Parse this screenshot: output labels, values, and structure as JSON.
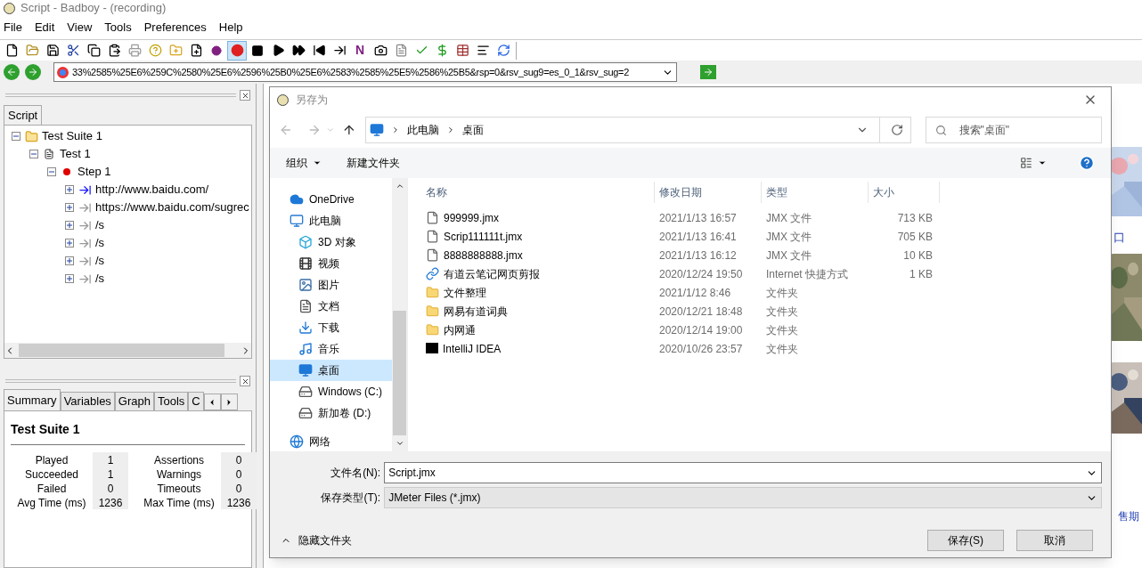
{
  "window": {
    "title": "Script - Badboy - (recording)"
  },
  "menu": [
    "File",
    "Edit",
    "View",
    "Tools",
    "Preferences",
    "Help"
  ],
  "toolbar": {
    "recording": true,
    "n_glyph": "N"
  },
  "address_bar": {
    "value": "33%2585%25E6%259C%2580%25E6%2596%25B0%25E6%2583%2585%25E5%2586%25B5&rsp=0&rsv_sug9=es_0_1&rsv_sug=2"
  },
  "script_panel": {
    "tabs": [
      {
        "label": "Script",
        "selected": true
      }
    ],
    "tree": [
      {
        "label": "Test Suite 1",
        "kind": "suite",
        "expanded": true,
        "children": [
          {
            "label": "Test 1",
            "kind": "test",
            "expanded": true,
            "children": [
              {
                "label": "Step 1",
                "kind": "step",
                "expanded": true,
                "children": [
                  {
                    "label": "http://www.baidu.com/",
                    "kind": "request-active",
                    "expanded": false
                  },
                  {
                    "label": "https://www.baidu.com/sugrec",
                    "kind": "request",
                    "expanded": false
                  },
                  {
                    "label": "/s",
                    "kind": "request",
                    "expanded": false
                  },
                  {
                    "label": "/s",
                    "kind": "request",
                    "expanded": false
                  },
                  {
                    "label": "/s",
                    "kind": "request",
                    "expanded": false
                  },
                  {
                    "label": "/s",
                    "kind": "request",
                    "expanded": false
                  }
                ]
              }
            ]
          }
        ]
      }
    ]
  },
  "summary_panel": {
    "tabs": [
      {
        "label": "Summary",
        "selected": true
      },
      {
        "label": "Variables",
        "selected": false
      },
      {
        "label": "Graph",
        "selected": false
      },
      {
        "label": "Tools",
        "selected": false
      },
      {
        "label": "C",
        "selected": false
      }
    ],
    "title": "Test Suite 1",
    "left_stats": [
      {
        "label": "Played",
        "value": "1"
      },
      {
        "label": "Succeeded",
        "value": "1"
      },
      {
        "label": "Failed",
        "value": "0"
      },
      {
        "label": "Avg Time (ms)",
        "value": "1236"
      }
    ],
    "right_stats": [
      {
        "label": "Assertions",
        "value": "0"
      },
      {
        "label": "Warnings",
        "value": "0"
      },
      {
        "label": "Timeouts",
        "value": "0"
      },
      {
        "label": "Max Time (ms)",
        "value": "1236"
      }
    ]
  },
  "background_page": {
    "fragments": [
      "口",
      "售期"
    ]
  },
  "dialog": {
    "title": "另存为",
    "breadcrumb": [
      "此电脑",
      "桌面"
    ],
    "search": {
      "placeholder": "搜索\"桌面\""
    },
    "toolbar": [
      "组织",
      "新建文件夹"
    ],
    "nav": [
      {
        "label": "OneDrive",
        "kind": "cloud",
        "selected": false
      },
      {
        "label": "此电脑",
        "kind": "pc",
        "selected": false,
        "children": [
          {
            "label": "3D 对象",
            "kind": "cube",
            "selected": false
          },
          {
            "label": "视频",
            "kind": "video",
            "selected": false
          },
          {
            "label": "图片",
            "kind": "pictures",
            "selected": false
          },
          {
            "label": "文档",
            "kind": "documents",
            "selected": false
          },
          {
            "label": "下载",
            "kind": "downloads",
            "selected": false
          },
          {
            "label": "音乐",
            "kind": "music",
            "selected": false
          },
          {
            "label": "桌面",
            "kind": "desktop",
            "selected": true
          },
          {
            "label": "Windows (C:)",
            "kind": "drive",
            "selected": false
          },
          {
            "label": "新加卷 (D:)",
            "kind": "drive",
            "selected": false
          }
        ]
      },
      {
        "label": "网络",
        "kind": "network",
        "selected": false
      }
    ],
    "columns": [
      "名称",
      "修改日期",
      "类型",
      "大小"
    ],
    "files": [
      {
        "name": "999999.jmx",
        "modified": "2021/1/13 16:57",
        "type": "JMX 文件",
        "size": "713 KB",
        "kind": "file"
      },
      {
        "name": "Scrip111111t.jmx",
        "modified": "2021/1/13 16:41",
        "type": "JMX 文件",
        "size": "705 KB",
        "kind": "file"
      },
      {
        "name": "8888888888.jmx",
        "modified": "2021/1/13 16:12",
        "type": "JMX 文件",
        "size": "10 KB",
        "kind": "file"
      },
      {
        "name": "有道云笔记网页剪报",
        "modified": "2020/12/24 19:50",
        "type": "Internet 快捷方式",
        "size": "1 KB",
        "kind": "shortcut"
      },
      {
        "name": "文件整理",
        "modified": "2021/1/12 8:46",
        "type": "文件夹",
        "kind": "folder"
      },
      {
        "name": "网易有道词典",
        "modified": "2020/12/21 18:48",
        "type": "文件夹",
        "kind": "folder"
      },
      {
        "name": "内网通",
        "modified": "2020/12/14 19:00",
        "type": "文件夹",
        "kind": "folder"
      },
      {
        "name": "IntelliJ IDEA",
        "modified": "2020/10/26 23:57",
        "type": "文件夹",
        "kind": "app"
      }
    ],
    "filename": {
      "label": "文件名(N):",
      "value": "Script.jmx"
    },
    "filetype": {
      "label": "保存类型(T):",
      "value": "JMeter Files (*.jmx)"
    },
    "hide_folders": "隐藏文件夹",
    "buttons": [
      "保存(S)",
      "取消"
    ]
  }
}
